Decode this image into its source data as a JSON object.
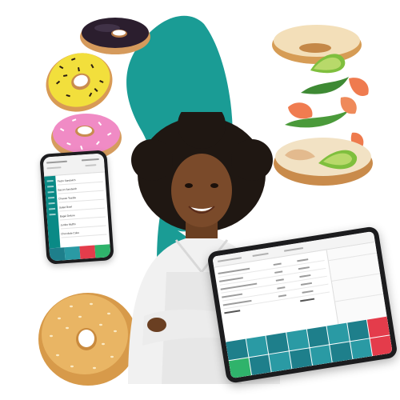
{
  "scene": {
    "colors": {
      "teal": "#1a9c95",
      "pos_teal": "#1e7f8b",
      "pos_green": "#2fb36b",
      "pos_red": "#e43c4b",
      "chef_top": "#f1f1f1",
      "skin": "#7a4a2a",
      "hair": "#1f1712"
    }
  },
  "phone": {
    "rows": [
      "Pesto Sandwich",
      "Bacon Sandwich",
      "Cheese Toastie",
      "Salad Bowl",
      "Bagel Deluxe",
      "Jumbo Muffin",
      "Chocolate Cake"
    ]
  },
  "tablet": {},
  "food": {
    "donut_choc": "chocolate-glazed-donut",
    "donut_yellow": "yellow-glazed-donut",
    "donut_pink": "pink-frosted-donut",
    "bagel_plain": "sesame-bagel",
    "bagel_salmon": "salmon-avocado-bagel"
  }
}
